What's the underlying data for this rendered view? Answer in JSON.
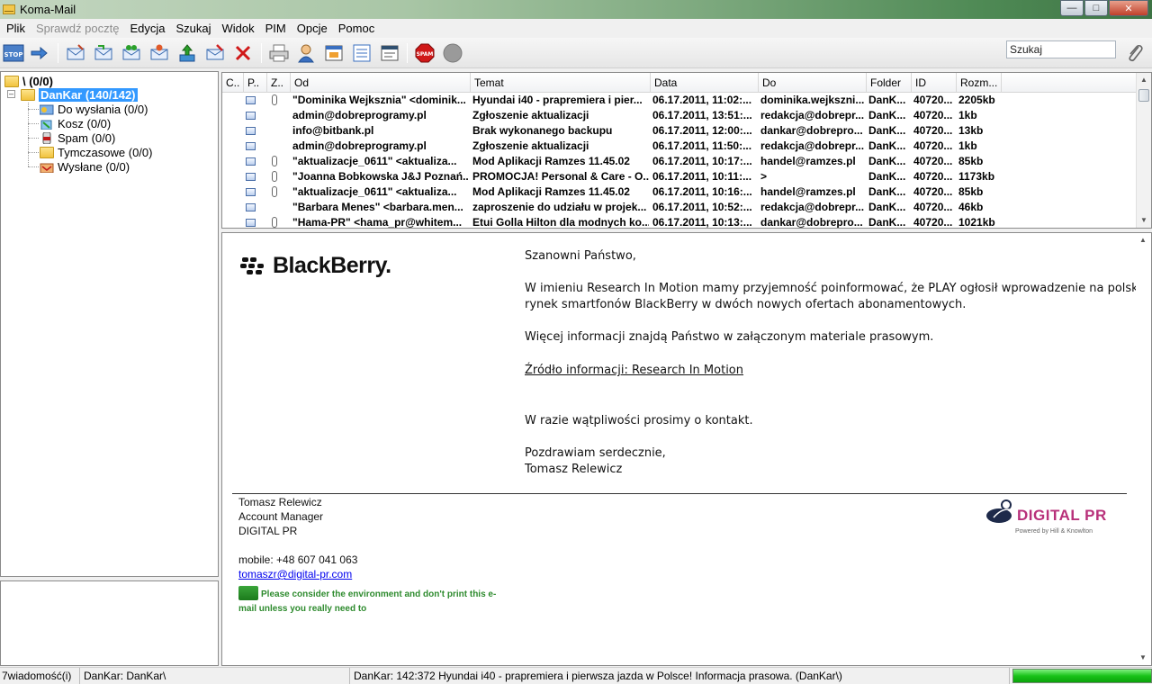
{
  "window": {
    "title": "Koma-Mail"
  },
  "menu": [
    {
      "label": "Plik",
      "disabled": false
    },
    {
      "label": "Sprawdź pocztę",
      "disabled": true
    },
    {
      "label": "Edycja",
      "disabled": false
    },
    {
      "label": "Szukaj",
      "disabled": false
    },
    {
      "label": "Widok",
      "disabled": false
    },
    {
      "label": "PIM",
      "disabled": false
    },
    {
      "label": "Opcje",
      "disabled": false
    },
    {
      "label": "Pomoc",
      "disabled": false
    }
  ],
  "toolbar": {
    "stop_label": "STOP",
    "spam_label": "SPAM",
    "search_value": "Szukaj"
  },
  "tree": {
    "root": "\\ (0/0)",
    "account": "DanKar (140/142)",
    "folders": [
      {
        "label": "Do wysłania (0/0)",
        "icon": "outbox-icon"
      },
      {
        "label": "Kosz (0/0)",
        "icon": "trash-icon"
      },
      {
        "label": "Spam (0/0)",
        "icon": "spam-icon"
      },
      {
        "label": "Tymczasowe (0/0)",
        "icon": "folder-icon"
      },
      {
        "label": "Wysłane (0/0)",
        "icon": "sent-icon"
      }
    ]
  },
  "list": {
    "columns": [
      "C..",
      "P..",
      "Z..",
      "Od",
      "Temat",
      "Data",
      "Do",
      "Folder",
      "ID",
      "Rozm..."
    ],
    "rows": [
      {
        "attach": true,
        "from": "\"Dominika Wejksznia\" <dominik...",
        "subject": "Hyundai i40 - prapremiera i pier...",
        "date": "06.17.2011, 11:02:...",
        "to": "dominika.wejkszni...",
        "folder": "DanK...",
        "id": "40720...",
        "size": "2205kb"
      },
      {
        "attach": false,
        "from": "admin@dobreprogramy.pl",
        "subject": "Zgłoszenie aktualizacji",
        "date": "06.17.2011, 13:51:...",
        "to": "redakcja@dobrepr...",
        "folder": "DanK...",
        "id": "40720...",
        "size": "1kb"
      },
      {
        "attach": false,
        "from": "info@bitbank.pl",
        "subject": "Brak wykonanego backupu",
        "date": "06.17.2011, 12:00:...",
        "to": "dankar@dobrepro...",
        "folder": "DanK...",
        "id": "40720...",
        "size": "13kb"
      },
      {
        "attach": false,
        "from": "admin@dobreprogramy.pl",
        "subject": "Zgłoszenie aktualizacji",
        "date": "06.17.2011, 11:50:...",
        "to": "redakcja@dobrepr...",
        "folder": "DanK...",
        "id": "40720...",
        "size": "1kb"
      },
      {
        "attach": true,
        "from": "\"aktualizacje_0611\" <aktualiza...",
        "subject": "Mod Aplikacji Ramzes 11.45.02",
        "date": "06.17.2011, 10:17:...",
        "to": "handel@ramzes.pl",
        "folder": "DanK...",
        "id": "40720...",
        "size": "85kb"
      },
      {
        "attach": true,
        "from": "\"Joanna Bobkowska J&J Poznań...",
        "subject": "PROMOCJA! Personal & Care  -  O...",
        "date": "06.17.2011, 10:11:...",
        "to": ">",
        "folder": "DanK...",
        "id": "40720...",
        "size": "1173kb"
      },
      {
        "attach": true,
        "from": "\"aktualizacje_0611\" <aktualiza...",
        "subject": "Mod Aplikacji Ramzes 11.45.02",
        "date": "06.17.2011, 10:16:...",
        "to": "handel@ramzes.pl",
        "folder": "DanK...",
        "id": "40720...",
        "size": "85kb"
      },
      {
        "attach": false,
        "from": "\"Barbara Menes\" <barbara.men...",
        "subject": "zaproszenie do udziału w projek...",
        "date": "06.17.2011, 10:52:...",
        "to": "redakcja@dobrepr...",
        "folder": "DanK...",
        "id": "40720...",
        "size": "46kb"
      },
      {
        "attach": true,
        "from": "\"Hama-PR\" <hama_pr@whitem...",
        "subject": "Etui Golla Hilton dla modnych ko...",
        "date": "06.17.2011, 10:13:...",
        "to": "dankar@dobrepro...",
        "folder": "DanK...",
        "id": "40720...",
        "size": "1021kb"
      }
    ]
  },
  "message": {
    "logo_text": "BlackBerry.",
    "greeting": "Szanowni Państwo,",
    "para1_line1": "W imieniu Research In Motion mamy przyjemność poinformować, że PLAY ogłosił wprowadzenie na polski",
    "para1_line2": "rynek smartfonów BlackBerry w dwóch nowych ofertach abonamentowych.",
    "para2": "Więcej informacji znajdą Państwo w załączonym materiale prasowym.",
    "source_link": "Źródło informacji: Research In Motion",
    "para3": "W razie wątpliwości prosimy o kontakt.",
    "closing": "Pozdrawiam serdecznie,",
    "closing_name": "Tomasz Relewicz",
    "sig_name": "Tomasz Relewicz",
    "sig_role": "Account Manager",
    "sig_company": "DIGITAL PR",
    "sig_mobile": "mobile: +48 607 041 063",
    "sig_email": "tomaszr@digital-pr.com",
    "eco_line1": "Please consider the environment and don't print this e-",
    "eco_line2": "mail unless you really need to",
    "dpr_logo": "DIGITAL PR",
    "dpr_sub": "Powered by Hill & Knowlton"
  },
  "status": {
    "count": "7wiadomość(i)",
    "account": "DanKar: DanKar\\",
    "current": "DanKar: 142:372 Hyundai i40 - prapremiera i pierwsza jazda w Polsce! Informacja prasowa. (DanKar\\)",
    "progress": 1.0
  },
  "colors": {
    "selection": "#3399ff",
    "eco_green": "#2e8b2e",
    "link_blue": "#0000ee",
    "brand_magenta": "#b8307a"
  }
}
